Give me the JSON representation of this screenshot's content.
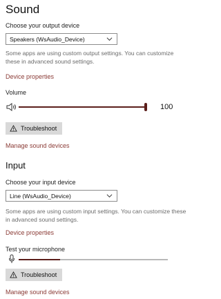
{
  "output": {
    "title": "Sound",
    "device_label": "Choose your output device",
    "device_value": "Speakers (WsAudio_Device)",
    "note": "Some apps are using custom output settings. You can customize these in advanced sound settings.",
    "device_properties": "Device properties",
    "volume_label": "Volume",
    "volume_value": "100",
    "volume_level": 1.0,
    "troubleshoot": "Troubleshoot",
    "manage": "Manage sound devices"
  },
  "input": {
    "title": "Input",
    "device_label": "Choose your input device",
    "device_value": "Line (WsAudio_Device)",
    "note": "Some apps are using custom input settings. You can customize these in advanced sound settings.",
    "device_properties": "Device properties",
    "mic_label": "Test your microphone",
    "mic_level": 0.28,
    "troubleshoot": "Troubleshoot",
    "manage": "Manage sound devices"
  },
  "colors": {
    "accent": "#5b1e1a",
    "link": "#8a3a35"
  },
  "icons": {
    "speaker": "speaker-icon",
    "microphone": "microphone-icon",
    "warning": "warning-icon",
    "chevron": "chevron-down-icon"
  }
}
